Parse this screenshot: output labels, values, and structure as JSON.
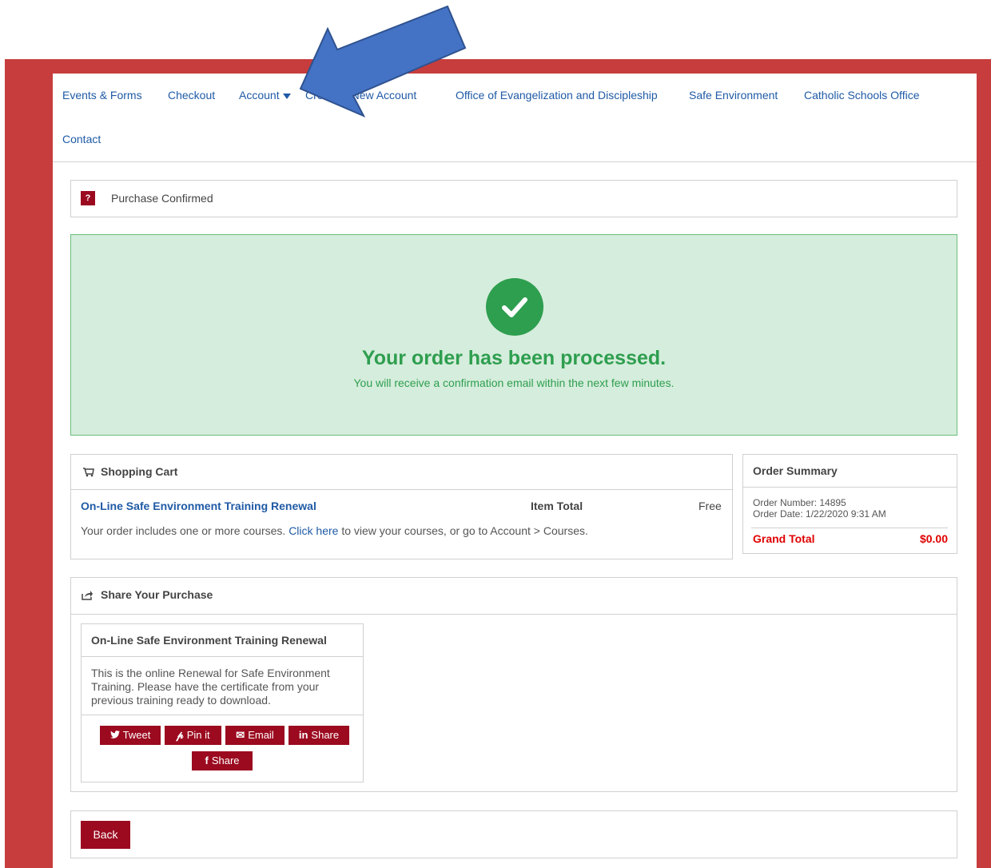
{
  "nav": {
    "items": [
      "Events & Forms",
      "Checkout",
      "Account",
      "Create a New Account",
      "Office of Evangelization and Discipleship",
      "Safe Environment",
      "Catholic Schools Office",
      "Contact"
    ]
  },
  "confirm": {
    "badge": "?",
    "title": "Purchase Confirmed"
  },
  "success": {
    "heading": "Your order has been processed.",
    "subtext": "You will receive a confirmation email within the next few minutes."
  },
  "cart": {
    "title": "Shopping Cart",
    "item_name": "On-Line Safe Environment Training Renewal",
    "item_total_label": "Item Total",
    "item_total_value": "Free",
    "note_prefix": "Your order includes one or more courses.",
    "note_link": "Click here",
    "note_suffix": "to view your courses, or go to Account > Courses."
  },
  "summary": {
    "title": "Order Summary",
    "order_number": "Order Number: 14895",
    "order_date": "Order Date: 1/22/2020 9:31 AM",
    "grand_total_label": "Grand Total",
    "grand_total_value": "$0.00"
  },
  "share": {
    "title": "Share Your Purchase",
    "card_title": "On-Line Safe Environment Training Renewal",
    "card_desc": "This is the online Renewal for Safe Environment Training. Please have the certificate from your previous training ready to download.",
    "buttons": {
      "tweet": "Tweet",
      "pin": "Pin it",
      "email": "Email",
      "linkedin": "Share",
      "facebook": "Share"
    }
  },
  "back_label": "Back",
  "colors": {
    "frame": "#c73d3d",
    "brand": "#9b0a1f",
    "link": "#1f5aa6",
    "success": "#2e9e4f",
    "annotation_arrow": "#4472c4"
  }
}
